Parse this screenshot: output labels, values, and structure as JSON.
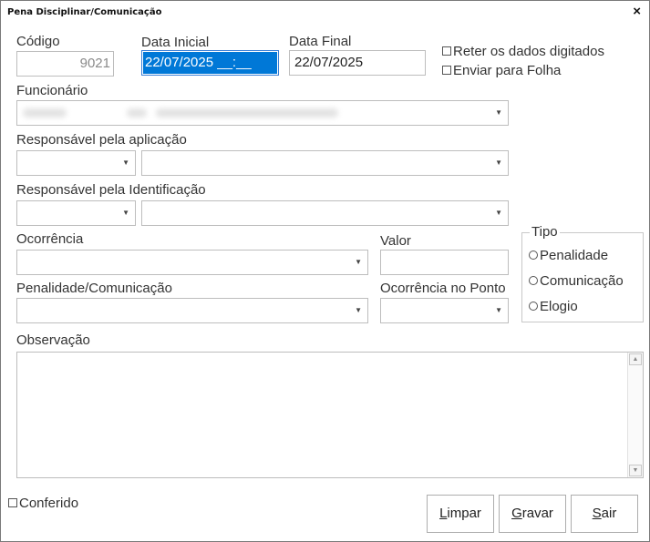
{
  "window": {
    "title": "Pena Disciplinar/Comunicação",
    "close_glyph": "×"
  },
  "codigo": {
    "label": "Código",
    "value": "9021"
  },
  "data_inicial": {
    "label": "Data Inicial",
    "value": "22/07/2025 __:__"
  },
  "data_final": {
    "label": "Data Final",
    "value": "22/07/2025"
  },
  "options": {
    "reter": {
      "label": "Reter os dados digitados",
      "checked": false
    },
    "enviar": {
      "label": "Enviar para Folha",
      "checked": false
    }
  },
  "funcionario": {
    "label": "Funcionário",
    "code": "",
    "name": ""
  },
  "responsavel_aplicacao": {
    "label": "Responsável pela aplicação",
    "code": "",
    "name": ""
  },
  "responsavel_identificacao": {
    "label": "Responsável pela Identificação",
    "code": "",
    "name": ""
  },
  "ocorrencia": {
    "label": "Ocorrência",
    "value": ""
  },
  "valor": {
    "label": "Valor",
    "value": ""
  },
  "penalidade": {
    "label": "Penalidade/Comunicação",
    "value": ""
  },
  "ocorrencia_ponto": {
    "label": "Ocorrência no Ponto",
    "value": ""
  },
  "tipo": {
    "legend": "Tipo",
    "options": [
      {
        "label": "Penalidade",
        "selected": false
      },
      {
        "label": "Comunicação",
        "selected": false
      },
      {
        "label": "Elogio",
        "selected": false
      }
    ]
  },
  "observacao": {
    "label": "Observação",
    "value": ""
  },
  "conferido": {
    "label": "Conferido",
    "checked": false
  },
  "buttons": {
    "limpar": {
      "first": "L",
      "rest": "impar"
    },
    "gravar": {
      "first": "G",
      "rest": "ravar"
    },
    "sair": {
      "first": "S",
      "rest": "air"
    }
  },
  "icons": {
    "dropdown": "chevron-down-icon",
    "checkbox": "checkbox-icon",
    "radio": "radio-icon",
    "close": "close-icon"
  }
}
